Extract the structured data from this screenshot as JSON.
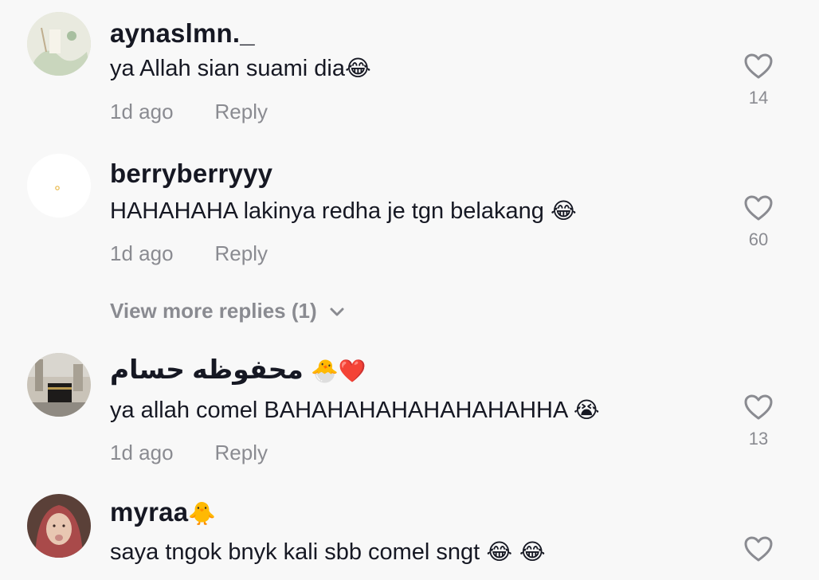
{
  "comments": [
    {
      "username": "aynaslmn._",
      "text": "ya Allah sian suami dia",
      "emoji": "😂",
      "time": "1d ago",
      "reply_label": "Reply",
      "likes": "14"
    },
    {
      "username": "berryberryyy",
      "text": "HAHAHAHA lakinya redha je tgn belakang ",
      "emoji": "😂",
      "time": "1d ago",
      "reply_label": "Reply",
      "likes": "60"
    },
    {
      "username": "محفوظه حسام",
      "username_emoji": "🐣❤️",
      "text": "ya allah comel BAHAHAHAHAHAHAHAHHA ",
      "emoji": "😭",
      "time": "1d ago",
      "reply_label": "Reply",
      "likes": "13"
    },
    {
      "username": "myraa",
      "username_emoji": "🐥",
      "text": "saya tngok bnyk kali sbb comel sngt ",
      "emoji": "😂 😂"
    }
  ],
  "view_more": {
    "label": "View more replies (1)"
  },
  "icons": {
    "like": "heart-outline-icon",
    "expand": "chevron-down-icon"
  },
  "colors": {
    "background": "#f8f8f8",
    "primary_text": "#161823",
    "secondary_text": "#8a8b91"
  }
}
